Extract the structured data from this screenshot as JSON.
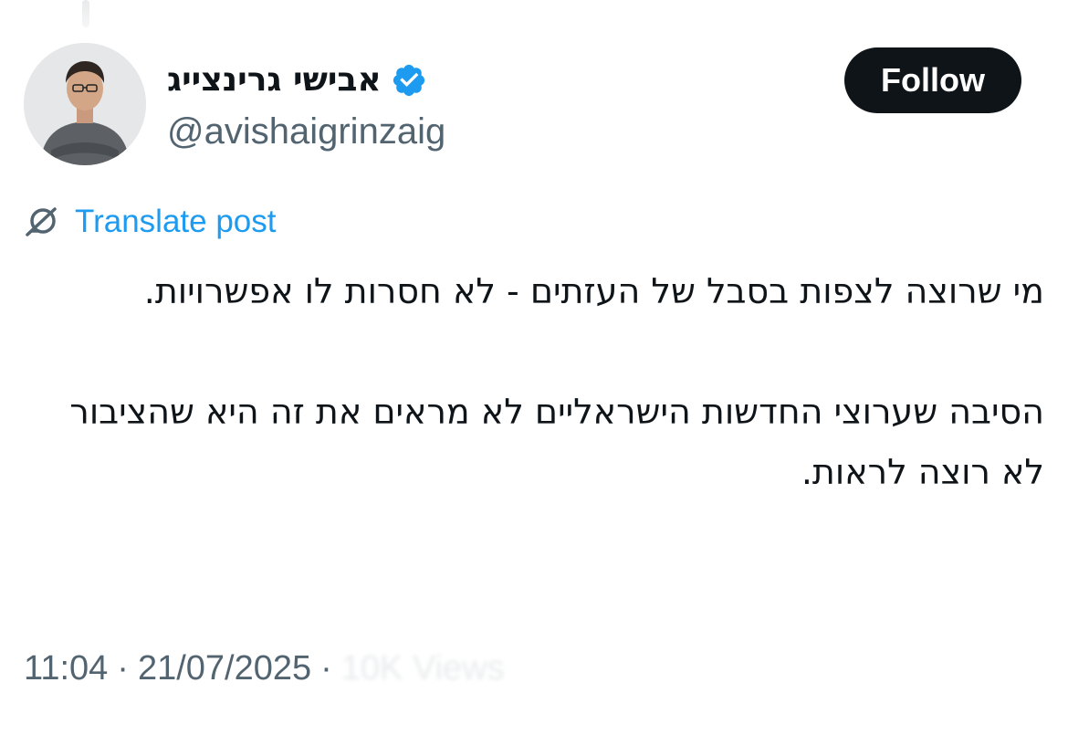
{
  "author": {
    "display_name": "אבישי גרינצייג",
    "handle": "@avishaigrinzaig",
    "verified": true,
    "avatar_icon": "person-avatar",
    "verified_icon": "verified-badge-icon"
  },
  "actions": {
    "follow_label": "Follow"
  },
  "translate": {
    "label": "Translate post",
    "icon": "globe-translate-icon"
  },
  "post": {
    "paragraphs": [
      "מי שרוצה לצפות בסבל של העזתים - לא חסרות לו אפשרויות.",
      "הסיבה שערוצי החדשות הישראליים לא מראים את זה היא שהציבור לא רוצה לראות."
    ]
  },
  "meta": {
    "time": "11:04",
    "separator": "·",
    "date": "21/07/2025",
    "views": "10K Views"
  },
  "colors": {
    "text_primary": "#0f1419",
    "text_secondary": "#536471",
    "link": "#1d9bf0",
    "verified_badge": "#1d9bf0",
    "follow_button_bg": "#0f1419",
    "follow_button_text": "#ffffff"
  }
}
